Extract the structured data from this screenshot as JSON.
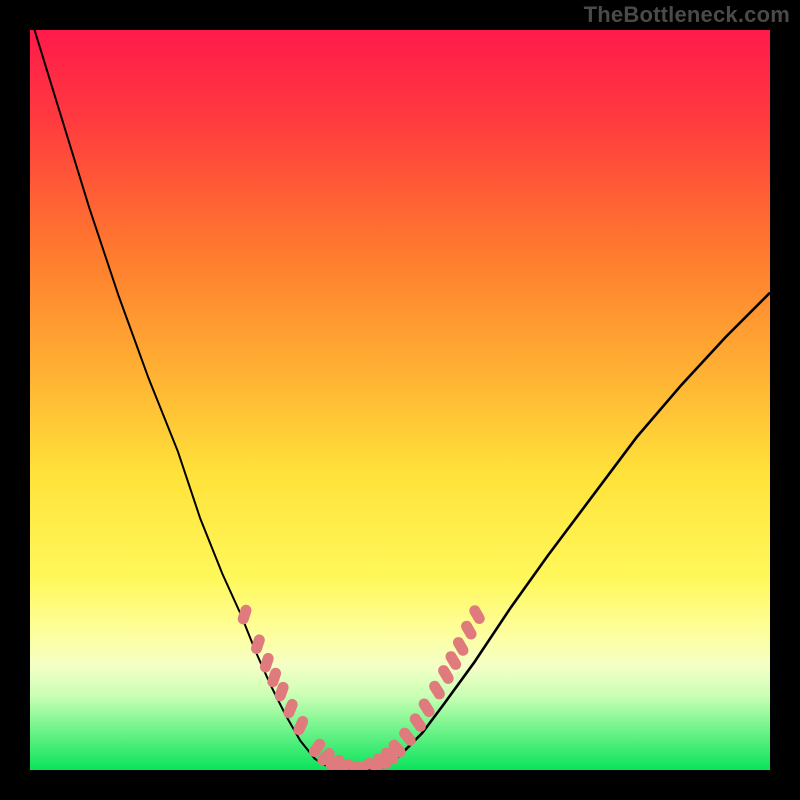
{
  "watermark": "TheBottleneck.com",
  "colors": {
    "gradient_top": "#ff1a4b",
    "gradient_bottom": "#09e35b",
    "curve": "#000000",
    "marker": "#df7b7c",
    "frame": "#000000"
  },
  "chart_data": {
    "type": "line",
    "title": "",
    "xlabel": "",
    "ylabel": "",
    "xlim": [
      0,
      100
    ],
    "ylim": [
      0,
      100
    ],
    "legend": null,
    "series": [
      {
        "name": "left-curve",
        "x": [
          0,
          4,
          8,
          12,
          16,
          20,
          23,
          26,
          28.5,
          30.5,
          32.5,
          34.5,
          36.5,
          38.5,
          40.5
        ],
        "y": [
          102,
          89,
          76,
          64,
          53,
          43,
          34,
          26.5,
          21,
          16,
          11.5,
          7.5,
          4,
          1.5,
          0.3
        ]
      },
      {
        "name": "valley-floor",
        "x": [
          40.5,
          42,
          44,
          46,
          47.5
        ],
        "y": [
          0.3,
          0.1,
          0.0,
          0.1,
          0.3
        ]
      },
      {
        "name": "right-curve",
        "x": [
          47.5,
          50,
          53,
          56,
          60,
          65,
          70,
          76,
          82,
          88,
          94,
          100
        ],
        "y": [
          0.3,
          2,
          5,
          9,
          14.5,
          22,
          29,
          37,
          45,
          52,
          58.5,
          64.5
        ]
      }
    ],
    "markers": {
      "name": "highlighted-points",
      "shape": "rounded-bar",
      "color": "#df7b7c",
      "points": [
        {
          "x": 29.0,
          "y": 21.0,
          "angle": -72
        },
        {
          "x": 30.8,
          "y": 17.0,
          "angle": -72
        },
        {
          "x": 32.0,
          "y": 14.5,
          "angle": -72
        },
        {
          "x": 33.0,
          "y": 12.5,
          "angle": -72
        },
        {
          "x": 34.0,
          "y": 10.6,
          "angle": -70
        },
        {
          "x": 35.2,
          "y": 8.3,
          "angle": -68
        },
        {
          "x": 36.6,
          "y": 6.0,
          "angle": -65
        },
        {
          "x": 38.8,
          "y": 3.0,
          "angle": -55
        },
        {
          "x": 40.0,
          "y": 1.8,
          "angle": -45
        },
        {
          "x": 41.2,
          "y": 1.0,
          "angle": -30
        },
        {
          "x": 42.4,
          "y": 0.6,
          "angle": -15
        },
        {
          "x": 44.5,
          "y": 0.4,
          "angle": 0
        },
        {
          "x": 46.4,
          "y": 0.7,
          "angle": 18
        },
        {
          "x": 47.6,
          "y": 1.2,
          "angle": 30
        },
        {
          "x": 48.6,
          "y": 1.9,
          "angle": 40
        },
        {
          "x": 49.6,
          "y": 2.9,
          "angle": 48
        },
        {
          "x": 51.0,
          "y": 4.5,
          "angle": 52
        },
        {
          "x": 52.4,
          "y": 6.4,
          "angle": 55
        },
        {
          "x": 53.6,
          "y": 8.4,
          "angle": 57
        },
        {
          "x": 55.0,
          "y": 10.8,
          "angle": 58
        },
        {
          "x": 56.2,
          "y": 12.9,
          "angle": 59
        },
        {
          "x": 57.2,
          "y": 14.8,
          "angle": 59
        },
        {
          "x": 58.2,
          "y": 16.7,
          "angle": 60
        },
        {
          "x": 59.3,
          "y": 18.9,
          "angle": 60
        },
        {
          "x": 60.4,
          "y": 21.0,
          "angle": 60
        }
      ]
    }
  }
}
